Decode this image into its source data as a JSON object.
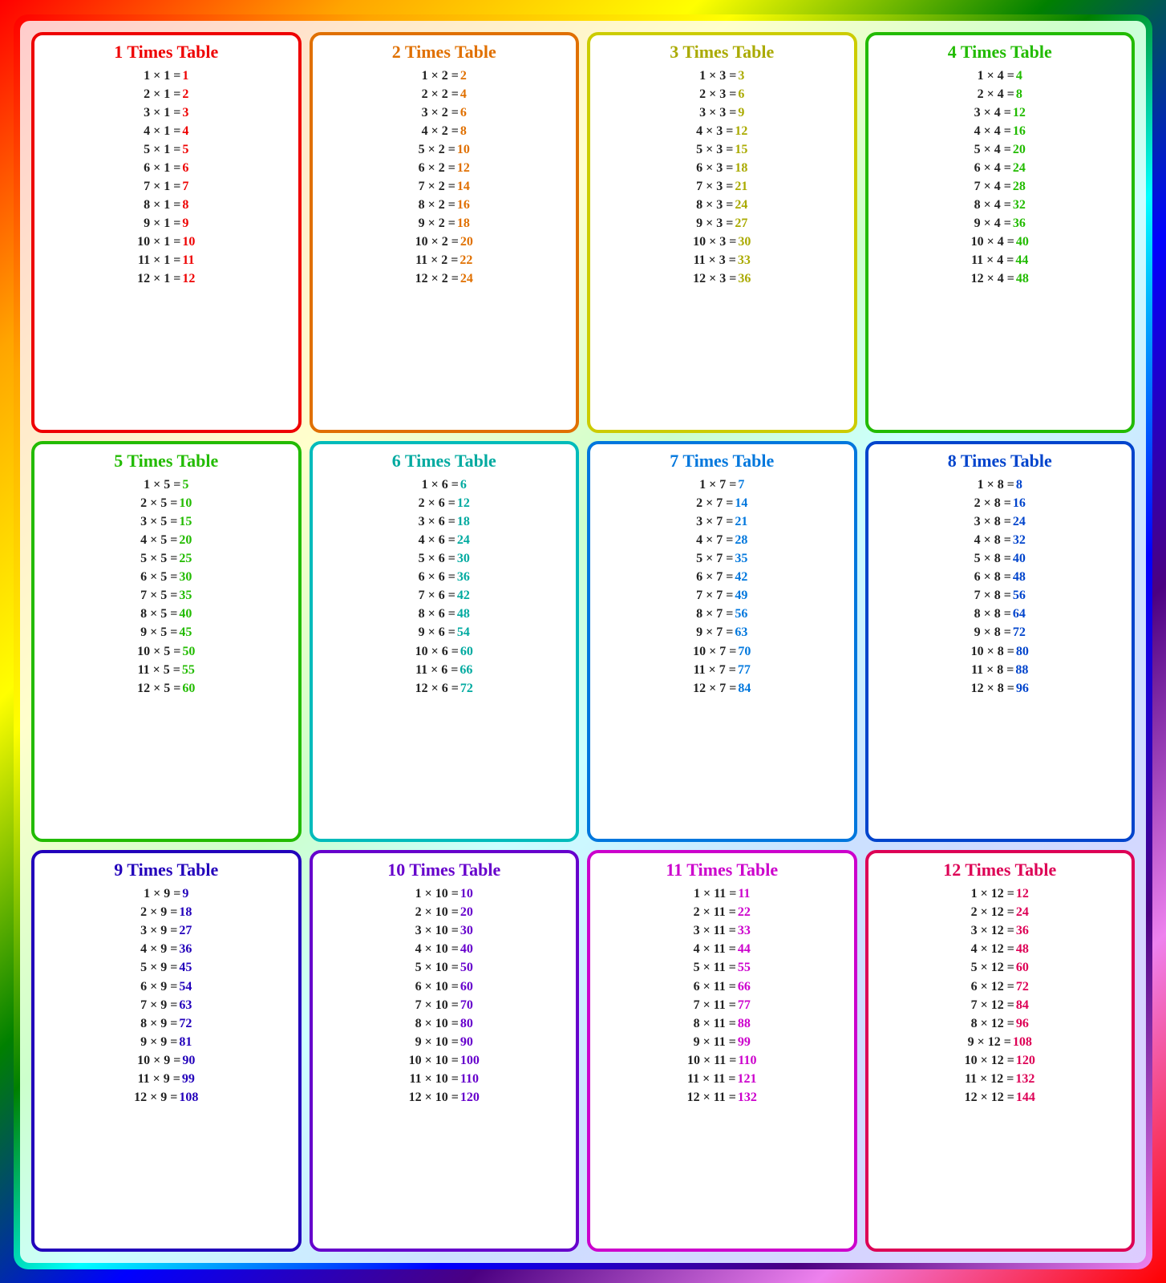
{
  "tables": [
    {
      "id": 1,
      "class": "t1",
      "title": "1 Times Table",
      "rows": [
        {
          "eq": "1 × 1 =",
          "result": "1"
        },
        {
          "eq": "2 × 1 =",
          "result": "2"
        },
        {
          "eq": "3 × 1 =",
          "result": "3"
        },
        {
          "eq": "4 × 1 =",
          "result": "4"
        },
        {
          "eq": "5 × 1 =",
          "result": "5"
        },
        {
          "eq": "6 × 1 =",
          "result": "6"
        },
        {
          "eq": "7 × 1 =",
          "result": "7"
        },
        {
          "eq": "8 × 1 =",
          "result": "8"
        },
        {
          "eq": "9 × 1 =",
          "result": "9"
        },
        {
          "eq": "10 × 1 =",
          "result": "10"
        },
        {
          "eq": "11 × 1 =",
          "result": "11"
        },
        {
          "eq": "12 × 1 =",
          "result": "12"
        }
      ]
    },
    {
      "id": 2,
      "class": "t2",
      "title": "2 Times Table",
      "rows": [
        {
          "eq": "1 × 2 =",
          "result": "2"
        },
        {
          "eq": "2 × 2 =",
          "result": "4"
        },
        {
          "eq": "3 × 2 =",
          "result": "6"
        },
        {
          "eq": "4 × 2 =",
          "result": "8"
        },
        {
          "eq": "5 × 2 =",
          "result": "10"
        },
        {
          "eq": "6 × 2 =",
          "result": "12"
        },
        {
          "eq": "7 × 2 =",
          "result": "14"
        },
        {
          "eq": "8 × 2 =",
          "result": "16"
        },
        {
          "eq": "9 × 2 =",
          "result": "18"
        },
        {
          "eq": "10 × 2 =",
          "result": "20"
        },
        {
          "eq": "11 × 2 =",
          "result": "22"
        },
        {
          "eq": "12 × 2 =",
          "result": "24"
        }
      ]
    },
    {
      "id": 3,
      "class": "t3",
      "title": "3 Times Table",
      "rows": [
        {
          "eq": "1 × 3 =",
          "result": "3"
        },
        {
          "eq": "2 × 3 =",
          "result": "6"
        },
        {
          "eq": "3 × 3 =",
          "result": "9"
        },
        {
          "eq": "4 × 3 =",
          "result": "12"
        },
        {
          "eq": "5 × 3 =",
          "result": "15"
        },
        {
          "eq": "6 × 3 =",
          "result": "18"
        },
        {
          "eq": "7 × 3 =",
          "result": "21"
        },
        {
          "eq": "8 × 3 =",
          "result": "24"
        },
        {
          "eq": "9 × 3 =",
          "result": "27"
        },
        {
          "eq": "10 × 3 =",
          "result": "30"
        },
        {
          "eq": "11 × 3 =",
          "result": "33"
        },
        {
          "eq": "12 × 3 =",
          "result": "36"
        }
      ]
    },
    {
      "id": 4,
      "class": "t4",
      "title": "4 Times Table",
      "rows": [
        {
          "eq": "1 × 4 =",
          "result": "4"
        },
        {
          "eq": "2 × 4 =",
          "result": "8"
        },
        {
          "eq": "3 × 4 =",
          "result": "12"
        },
        {
          "eq": "4 × 4 =",
          "result": "16"
        },
        {
          "eq": "5 × 4 =",
          "result": "20"
        },
        {
          "eq": "6 × 4 =",
          "result": "24"
        },
        {
          "eq": "7 × 4 =",
          "result": "28"
        },
        {
          "eq": "8 × 4 =",
          "result": "32"
        },
        {
          "eq": "9 × 4 =",
          "result": "36"
        },
        {
          "eq": "10 × 4 =",
          "result": "40"
        },
        {
          "eq": "11 × 4 =",
          "result": "44"
        },
        {
          "eq": "12 × 4 =",
          "result": "48"
        }
      ]
    },
    {
      "id": 5,
      "class": "t5",
      "title": "5 Times Table",
      "rows": [
        {
          "eq": "1 × 5 =",
          "result": "5"
        },
        {
          "eq": "2 × 5 =",
          "result": "10"
        },
        {
          "eq": "3 × 5 =",
          "result": "15"
        },
        {
          "eq": "4 × 5 =",
          "result": "20"
        },
        {
          "eq": "5 × 5 =",
          "result": "25"
        },
        {
          "eq": "6 × 5 =",
          "result": "30"
        },
        {
          "eq": "7 × 5 =",
          "result": "35"
        },
        {
          "eq": "8 × 5 =",
          "result": "40"
        },
        {
          "eq": "9 × 5 =",
          "result": "45"
        },
        {
          "eq": "10 × 5 =",
          "result": "50"
        },
        {
          "eq": "11 × 5 =",
          "result": "55"
        },
        {
          "eq": "12 × 5 =",
          "result": "60"
        }
      ]
    },
    {
      "id": 6,
      "class": "t6",
      "title": "6 Times Table",
      "rows": [
        {
          "eq": "1 × 6 =",
          "result": "6"
        },
        {
          "eq": "2 × 6 =",
          "result": "12"
        },
        {
          "eq": "3 × 6 =",
          "result": "18"
        },
        {
          "eq": "4 × 6 =",
          "result": "24"
        },
        {
          "eq": "5 × 6 =",
          "result": "30"
        },
        {
          "eq": "6 × 6 =",
          "result": "36"
        },
        {
          "eq": "7 × 6 =",
          "result": "42"
        },
        {
          "eq": "8 × 6 =",
          "result": "48"
        },
        {
          "eq": "9 × 6 =",
          "result": "54"
        },
        {
          "eq": "10 × 6 =",
          "result": "60"
        },
        {
          "eq": "11 × 6 =",
          "result": "66"
        },
        {
          "eq": "12 × 6 =",
          "result": "72"
        }
      ]
    },
    {
      "id": 7,
      "class": "t7",
      "title": "7 Times Table",
      "rows": [
        {
          "eq": "1 × 7 =",
          "result": "7"
        },
        {
          "eq": "2 × 7 =",
          "result": "14"
        },
        {
          "eq": "3 × 7 =",
          "result": "21"
        },
        {
          "eq": "4 × 7 =",
          "result": "28"
        },
        {
          "eq": "5 × 7 =",
          "result": "35"
        },
        {
          "eq": "6 × 7 =",
          "result": "42"
        },
        {
          "eq": "7 × 7 =",
          "result": "49"
        },
        {
          "eq": "8 × 7 =",
          "result": "56"
        },
        {
          "eq": "9 × 7 =",
          "result": "63"
        },
        {
          "eq": "10 × 7 =",
          "result": "70"
        },
        {
          "eq": "11 × 7 =",
          "result": "77"
        },
        {
          "eq": "12 × 7 =",
          "result": "84"
        }
      ]
    },
    {
      "id": 8,
      "class": "t8",
      "title": "8 Times Table",
      "rows": [
        {
          "eq": "1 × 8 =",
          "result": "8"
        },
        {
          "eq": "2 × 8 =",
          "result": "16"
        },
        {
          "eq": "3 × 8 =",
          "result": "24"
        },
        {
          "eq": "4 × 8 =",
          "result": "32"
        },
        {
          "eq": "5 × 8 =",
          "result": "40"
        },
        {
          "eq": "6 × 8 =",
          "result": "48"
        },
        {
          "eq": "7 × 8 =",
          "result": "56"
        },
        {
          "eq": "8 × 8 =",
          "result": "64"
        },
        {
          "eq": "9 × 8 =",
          "result": "72"
        },
        {
          "eq": "10 × 8 =",
          "result": "80"
        },
        {
          "eq": "11 × 8 =",
          "result": "88"
        },
        {
          "eq": "12 × 8 =",
          "result": "96"
        }
      ]
    },
    {
      "id": 9,
      "class": "t9",
      "title": "9 Times Table",
      "rows": [
        {
          "eq": "1 × 9 =",
          "result": "9"
        },
        {
          "eq": "2 × 9 =",
          "result": "18"
        },
        {
          "eq": "3 × 9 =",
          "result": "27"
        },
        {
          "eq": "4 × 9 =",
          "result": "36"
        },
        {
          "eq": "5 × 9 =",
          "result": "45"
        },
        {
          "eq": "6 × 9 =",
          "result": "54"
        },
        {
          "eq": "7 × 9 =",
          "result": "63"
        },
        {
          "eq": "8 × 9 =",
          "result": "72"
        },
        {
          "eq": "9 × 9 =",
          "result": "81"
        },
        {
          "eq": "10 × 9 =",
          "result": "90"
        },
        {
          "eq": "11 × 9 =",
          "result": "99"
        },
        {
          "eq": "12 × 9 =",
          "result": "108"
        }
      ]
    },
    {
      "id": 10,
      "class": "t10",
      "title": "10 Times Table",
      "rows": [
        {
          "eq": "1 × 10 =",
          "result": "10"
        },
        {
          "eq": "2 × 10 =",
          "result": "20"
        },
        {
          "eq": "3 × 10 =",
          "result": "30"
        },
        {
          "eq": "4 × 10 =",
          "result": "40"
        },
        {
          "eq": "5 × 10 =",
          "result": "50"
        },
        {
          "eq": "6 × 10 =",
          "result": "60"
        },
        {
          "eq": "7 × 10 =",
          "result": "70"
        },
        {
          "eq": "8 × 10 =",
          "result": "80"
        },
        {
          "eq": "9 × 10 =",
          "result": "90"
        },
        {
          "eq": "10 × 10 =",
          "result": "100"
        },
        {
          "eq": "11 × 10 =",
          "result": "110"
        },
        {
          "eq": "12 × 10 =",
          "result": "120"
        }
      ]
    },
    {
      "id": 11,
      "class": "t11",
      "title": "11 Times Table",
      "rows": [
        {
          "eq": "1 × 11 =",
          "result": "11"
        },
        {
          "eq": "2 × 11 =",
          "result": "22"
        },
        {
          "eq": "3 × 11 =",
          "result": "33"
        },
        {
          "eq": "4 × 11 =",
          "result": "44"
        },
        {
          "eq": "5 × 11 =",
          "result": "55"
        },
        {
          "eq": "6 × 11 =",
          "result": "66"
        },
        {
          "eq": "7 × 11 =",
          "result": "77"
        },
        {
          "eq": "8 × 11 =",
          "result": "88"
        },
        {
          "eq": "9 × 11 =",
          "result": "99"
        },
        {
          "eq": "10 × 11 =",
          "result": "110"
        },
        {
          "eq": "11 × 11 =",
          "result": "121"
        },
        {
          "eq": "12 × 11 =",
          "result": "132"
        }
      ]
    },
    {
      "id": 12,
      "class": "t12",
      "title": "12 Times Table",
      "rows": [
        {
          "eq": "1 × 12 =",
          "result": "12"
        },
        {
          "eq": "2 × 12 =",
          "result": "24"
        },
        {
          "eq": "3 × 12 =",
          "result": "36"
        },
        {
          "eq": "4 × 12 =",
          "result": "48"
        },
        {
          "eq": "5 × 12 =",
          "result": "60"
        },
        {
          "eq": "6 × 12 =",
          "result": "72"
        },
        {
          "eq": "7 × 12 =",
          "result": "84"
        },
        {
          "eq": "8 × 12 =",
          "result": "96"
        },
        {
          "eq": "9 × 12 =",
          "result": "108"
        },
        {
          "eq": "10 × 12 =",
          "result": "120"
        },
        {
          "eq": "11 × 12 =",
          "result": "132"
        },
        {
          "eq": "12 × 12 =",
          "result": "144"
        }
      ]
    }
  ]
}
